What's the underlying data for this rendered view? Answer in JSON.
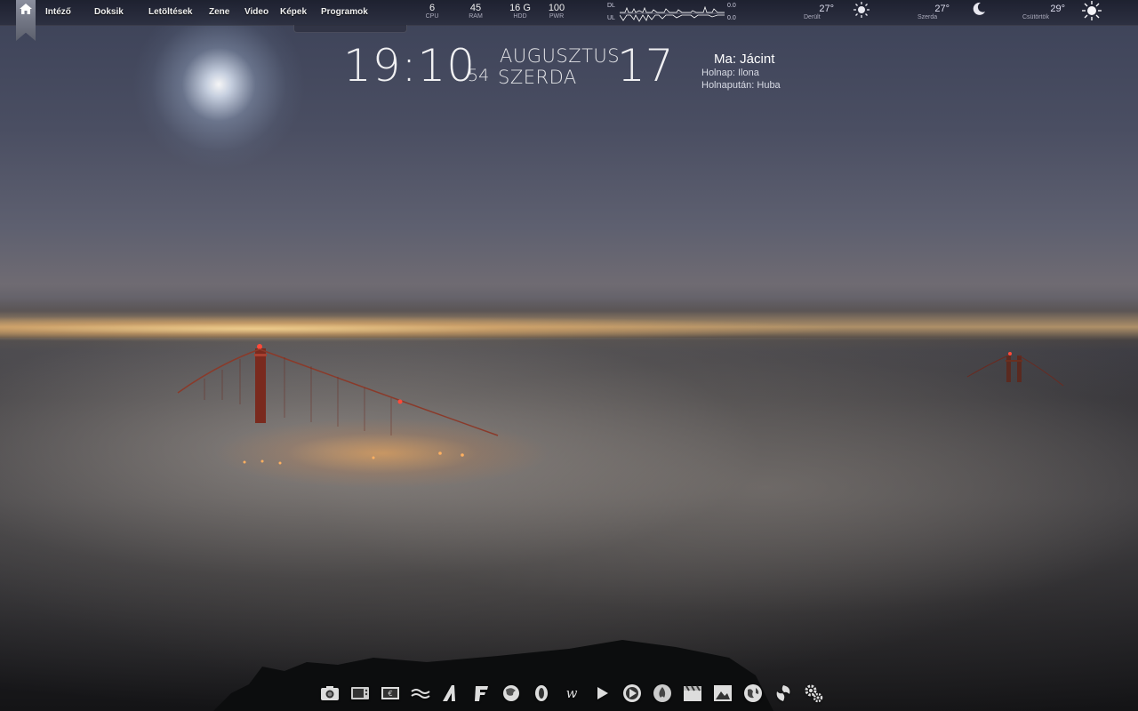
{
  "menu": {
    "items": [
      "Intéző",
      "Doksik",
      "Letöltések",
      "Zene",
      "Video",
      "Képek",
      "Programok"
    ]
  },
  "stats": [
    {
      "value": "6",
      "label": "CPU"
    },
    {
      "value": "45",
      "label": "RAM"
    },
    {
      "value": "16 G",
      "label": "HDD"
    },
    {
      "value": "100",
      "label": "PWR"
    }
  ],
  "network": {
    "dl_label": "DL",
    "ul_label": "UL",
    "dl_value": "0.0",
    "ul_value": "0.0"
  },
  "weather": [
    {
      "temp": "27°",
      "desc": "Derült",
      "icon": "sun-icon"
    },
    {
      "temp": "27°",
      "desc": "Szerda",
      "icon": "moon-icon"
    },
    {
      "temp": "29°",
      "desc": "Csütörtök",
      "icon": "sun-bright-icon"
    }
  ],
  "clock": {
    "time": "19:10",
    "seconds": "54",
    "month": "AUGUSZTUS",
    "weekday": "SZERDA",
    "day": "17"
  },
  "namedays": {
    "today": "Ma: Jácint",
    "tomorrow": "Holnap: Ilona",
    "day_after": "Holnapután: Huba"
  },
  "dock": {
    "icons": [
      "camera-icon",
      "tv-icon",
      "screen-icon",
      "waves-icon",
      "letter-a-icon",
      "letter-f-icon",
      "firefox-icon",
      "opera-icon",
      "uplay-icon",
      "play-icon",
      "media-player-icon",
      "fire-icon",
      "clapperboard-icon",
      "photo-icon",
      "globe-icon",
      "swirl-icon",
      "settings-gears-icon"
    ]
  },
  "colors": {
    "bar": "#1e2130",
    "text": "#ffffff",
    "subtext": "#aab0bb"
  }
}
